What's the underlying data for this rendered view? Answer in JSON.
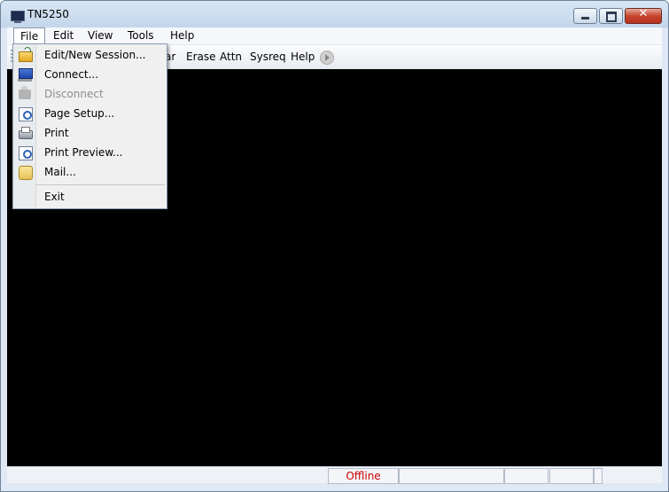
{
  "window": {
    "title": "TN5250"
  },
  "menubar": {
    "items": [
      "File",
      "Edit",
      "View",
      "Tools",
      "Help"
    ]
  },
  "toolbar": {
    "items": [
      "ar",
      "Erase",
      "Attn",
      "Sysreq",
      "Help"
    ]
  },
  "file_menu": {
    "items": [
      {
        "label": "Edit/New Session...",
        "icon": "open-folder-icon",
        "disabled": false
      },
      {
        "label": "Connect...",
        "icon": "connect-icon",
        "disabled": false
      },
      {
        "label": "Disconnect",
        "icon": "disconnect-icon",
        "disabled": true
      },
      {
        "label": "Page Setup...",
        "icon": "page-setup-icon",
        "disabled": false
      },
      {
        "label": "Print",
        "icon": "printer-icon",
        "disabled": false
      },
      {
        "label": "Print Preview...",
        "icon": "print-preview-icon",
        "disabled": false
      },
      {
        "label": "Mail...",
        "icon": "mail-icon",
        "disabled": false
      },
      {
        "label": "Exit",
        "icon": "",
        "disabled": false
      }
    ]
  },
  "statusbar": {
    "connection_status": "Offline"
  },
  "colors": {
    "terminal_bg": "#000000",
    "status_offline": "#cc0000"
  }
}
